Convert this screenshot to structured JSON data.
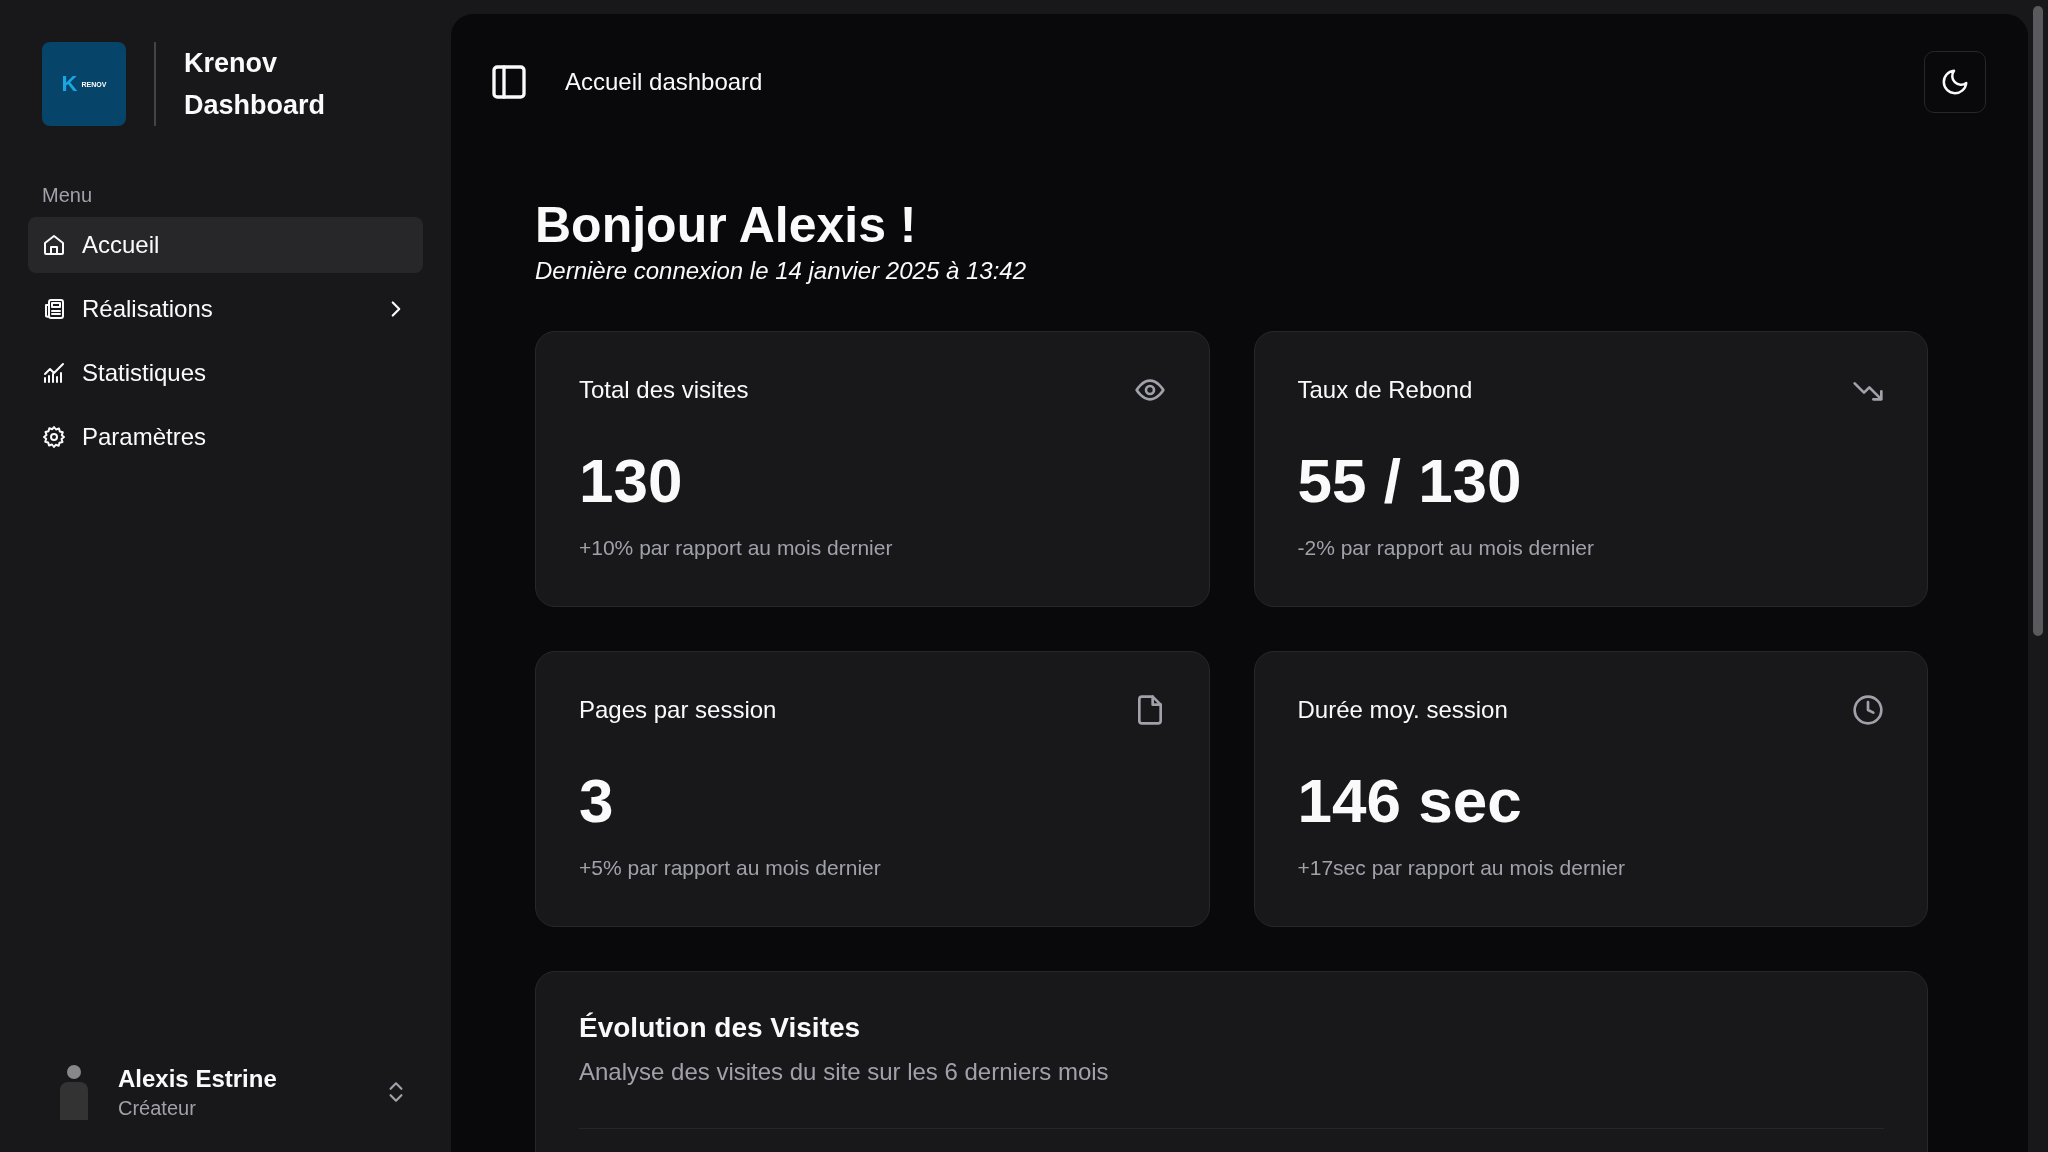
{
  "brand": {
    "logo_mark": "K",
    "logo_text": "RENOV",
    "title": "Krenov Dashboard"
  },
  "sidebar": {
    "section_label": "Menu",
    "items": [
      {
        "label": "Accueil",
        "selected": true,
        "kind": "link"
      },
      {
        "label": "Réalisations",
        "selected": false,
        "kind": "group"
      },
      {
        "label": "Statistiques",
        "selected": false,
        "kind": "link"
      },
      {
        "label": "Paramètres",
        "selected": false,
        "kind": "link"
      }
    ],
    "user": {
      "name": "Alexis Estrine",
      "role": "Créateur"
    }
  },
  "header": {
    "title": "Accueil dashboard"
  },
  "greeting": {
    "title": "Bonjour Alexis !",
    "subtitle": "Dernière connexion le 14 janvier 2025 à 13:42"
  },
  "stats": [
    {
      "label": "Total des visites",
      "value": "130",
      "change": "+10% par rapport au mois dernier"
    },
    {
      "label": "Taux de Rebond",
      "value": "55 / 130",
      "change": "-2% par rapport au mois dernier"
    },
    {
      "label": "Pages par session",
      "value": "3",
      "change": "+5% par rapport au mois dernier"
    },
    {
      "label": "Durée moy. session",
      "value": "146 sec",
      "change": "+17sec par rapport au mois dernier"
    }
  ],
  "chart_card": {
    "title": "Évolution des Visites",
    "subtitle": "Analyse des visites du site sur les 6 derniers mois"
  }
}
